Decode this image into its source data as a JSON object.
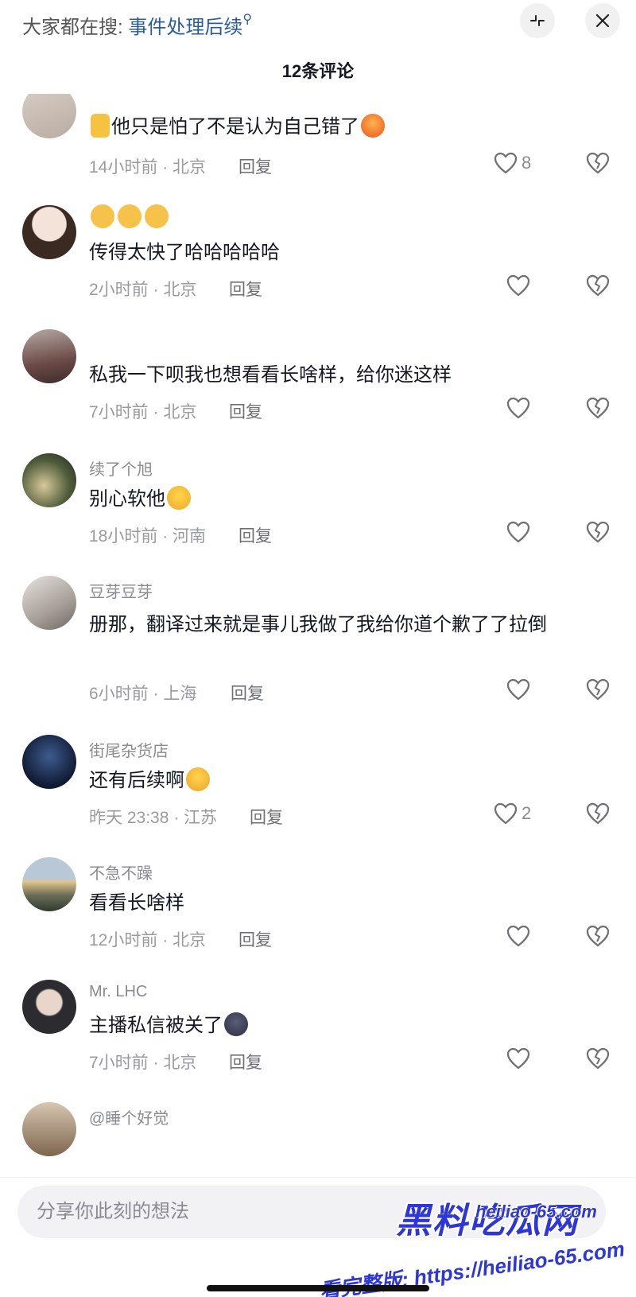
{
  "header": {
    "search_prefix": "大家都在搜:",
    "search_keyword": "事件处理后续",
    "search_icon": "search-icon",
    "collapse_icon": "collapse-icon",
    "close_icon": "close-icon",
    "comment_count_title": "12条评论"
  },
  "comments": [
    {
      "nickname": "",
      "text": "他只是怕了不是认为自己错了",
      "emoji_before": "thumbs-up-icon",
      "emoji_after": "angry-face-icon",
      "time": "14小时前 · 北京",
      "reply_label": "回复",
      "likes": "8"
    },
    {
      "nickname": "",
      "text": "传得太快了哈哈哈哈哈",
      "emoji_line": [
        "shocked-face-icon",
        "shocked-face-icon",
        "shocked-face-icon"
      ],
      "time": "2小时前 · 北京",
      "reply_label": "回复",
      "likes": ""
    },
    {
      "nickname": "",
      "text": "私我一下呗我也想看看长啥样，给你迷这样",
      "time": "7小时前 · 北京",
      "reply_label": "回复",
      "likes": ""
    },
    {
      "nickname": "续了个旭",
      "text": "别心软他",
      "emoji_after": "laughing-crying-icon",
      "time": "18小时前 · 河南",
      "reply_label": "回复",
      "likes": ""
    },
    {
      "nickname": "豆芽豆芽",
      "text": "册那，翻译过来就是事儿我做了我给你道个歉了了拉倒",
      "time": "6小时前 · 上海",
      "reply_label": "回复",
      "likes": ""
    },
    {
      "nickname": "街尾杂货店",
      "text": "还有后续啊",
      "emoji_after": "thinking-face-icon",
      "time": "昨天 23:38 · 江苏",
      "reply_label": "回复",
      "likes": "2"
    },
    {
      "nickname": "不急不躁",
      "text": "看看长啥样",
      "time": "12小时前 · 北京",
      "reply_label": "回复",
      "likes": ""
    },
    {
      "nickname": "Mr. LHC",
      "text": "主播私信被关了",
      "emoji_after": "dark-face-icon",
      "time": "7小时前 · 北京",
      "reply_label": "回复",
      "likes": ""
    },
    {
      "nickname": "@睡个好觉",
      "text": "",
      "time": "",
      "reply_label": "",
      "likes": ""
    }
  ],
  "input": {
    "placeholder": "分享你此刻的想法"
  },
  "watermark": {
    "logo": "黑料吃瓜网",
    "url": "heiliao-65.com",
    "cta": "看完整版: https://heiliao-65.com"
  },
  "colors": {
    "keyword": "#2a5d9f",
    "text": "#161823",
    "meta": "#9a9ba0",
    "watermark": "#2d36d8"
  }
}
